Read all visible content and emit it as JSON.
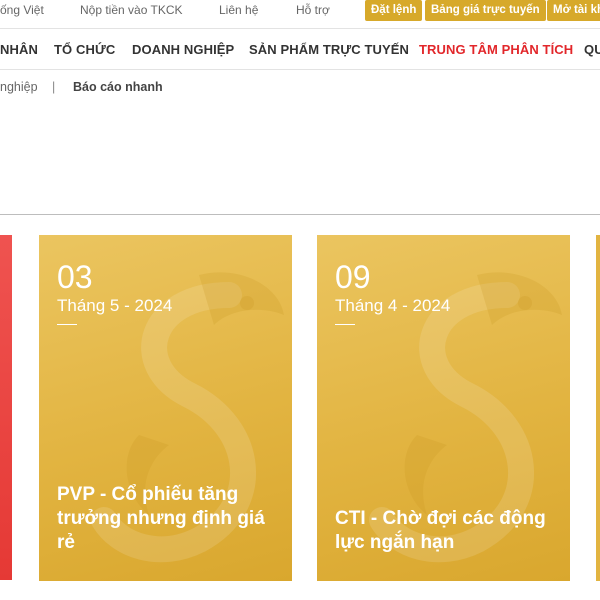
{
  "topbar": {
    "links": [
      "ống Việt",
      "Nộp tiền vào TKCK",
      "Liên hệ",
      "Hỗ trợ"
    ],
    "buttons": [
      "Đặt lệnh",
      "Bảng giá trực tuyến",
      "Mở tài kh"
    ]
  },
  "nav": {
    "items": [
      "NHÂN",
      "TỔ CHỨC",
      "DOANH NGHIỆP",
      "SẢN PHẨM TRỰC TUYẾN",
      "TRUNG TÂM PHÂN TÍCH",
      "QU"
    ],
    "active_index": 4
  },
  "breadcrumb": {
    "items": [
      "nghiệp",
      "Báo cáo nhanh"
    ],
    "separator": "|"
  },
  "cards": [
    {
      "day": "03",
      "month": "Tháng 5 - 2024",
      "title": "PVP - Cổ phiếu tăng trưởng nhưng định giá rẻ"
    },
    {
      "day": "09",
      "month": "Tháng 4 - 2024",
      "title": "CTI - Chờ đợi các động lực ngắn hạn"
    }
  ],
  "colors": {
    "accent_red": "#e2272b",
    "gold": "#d7a92a",
    "card_gold": "#e2b441"
  },
  "icons": [
    "dragon-watermark-icon"
  ]
}
